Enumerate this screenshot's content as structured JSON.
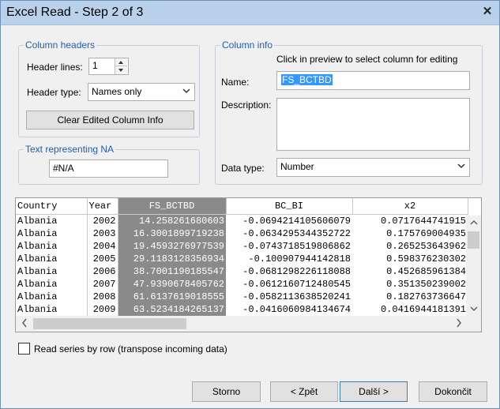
{
  "window": {
    "title": "Excel Read - Step 2 of 3",
    "close_glyph": "✕"
  },
  "column_headers": {
    "legend": "Column headers",
    "header_lines_label": "Header lines:",
    "header_lines_value": "1",
    "header_type_label": "Header type:",
    "header_type_value": "Names only",
    "clear_button": "Clear Edited Column Info"
  },
  "na": {
    "legend": "Text representing NA",
    "value": "#N/A"
  },
  "column_info": {
    "legend": "Column info",
    "hint": "Click in preview to select column for editing",
    "name_label": "Name:",
    "name_value": "FS_BCTBD",
    "description_label": "Description:",
    "description_value": "",
    "data_type_label": "Data type:",
    "data_type_value": "Number"
  },
  "preview": {
    "headers": [
      "Country",
      "Year",
      "FS_BCTBD",
      "BC_BI",
      "x2"
    ],
    "rows": [
      [
        "Albania",
        "2002",
        "14.2582616806​03",
        "-0.0694214105606079",
        "0.071764474191​5"
      ],
      [
        "Albania",
        "2003",
        "16.3001899719238",
        "-0.0634295344352722",
        "0.175769004935"
      ],
      [
        "Albania",
        "2004",
        "19.4593276977539",
        "-0.0743718519806862",
        "0.265253643962"
      ],
      [
        "Albania",
        "2005",
        "29.1183128356934",
        "-0.100907944142818",
        "0.598376230302"
      ],
      [
        "Albania",
        "2006",
        "38.7001190185547",
        "-0.0681298226118088",
        "0.452685961384"
      ],
      [
        "Albania",
        "2007",
        "47.9390678405762",
        "-0.0612160712480545",
        "0.351350239002"
      ],
      [
        "Albania",
        "2008",
        "61.6137619018555",
        "-0.0582113638520241",
        "0.182763736647"
      ],
      [
        "Albania",
        "2009",
        "63.5234184265137",
        "-0.0416060984134674",
        "0.0416944181391"
      ]
    ]
  },
  "transpose_label": "Read series by row (transpose incoming data)",
  "buttons": {
    "cancel": "Storno",
    "back": "< Zpět",
    "next": "Další >",
    "finish": "Dokončit"
  }
}
